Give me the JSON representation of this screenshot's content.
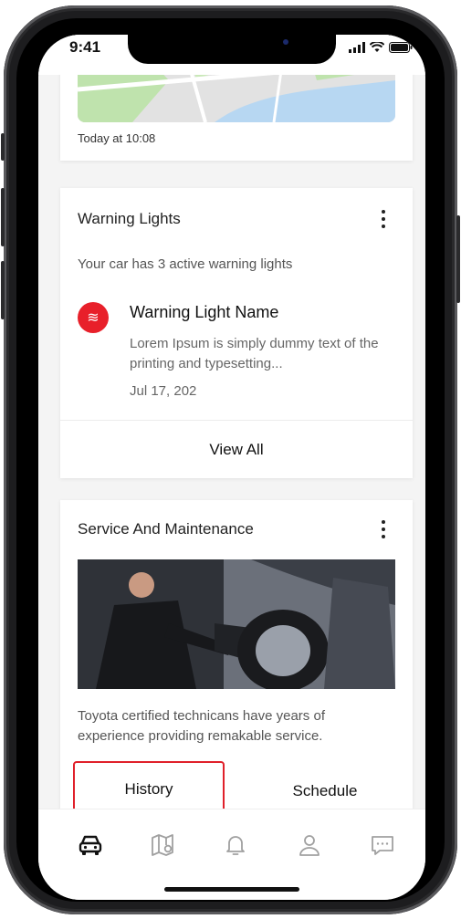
{
  "status_bar": {
    "time": "9:41"
  },
  "map_card": {
    "timestamp": "Today at 10:08"
  },
  "warning_card": {
    "title": "Warning Lights",
    "subtitle": "Your car has 3 active warning lights",
    "item": {
      "icon": "warning-light-icon",
      "name": "Warning Light Name",
      "description": "Lorem Ipsum is simply dummy text of the printing and typesetting...",
      "date": "Jul 17, 202"
    },
    "view_all_label": "View All"
  },
  "service_card": {
    "title": "Service And Maintenance",
    "description": "Toyota certified technicans have years of experience providing remakable service.",
    "tabs": [
      {
        "label": "History",
        "selected": true
      },
      {
        "label": "Schedule",
        "selected": false
      }
    ]
  },
  "bottom_nav": {
    "items": [
      {
        "icon": "car-icon",
        "active": true
      },
      {
        "icon": "map-icon",
        "active": false
      },
      {
        "icon": "bell-icon",
        "active": false
      },
      {
        "icon": "person-icon",
        "active": false
      },
      {
        "icon": "chat-icon",
        "active": false
      }
    ]
  },
  "colors": {
    "accent_red": "#e8202a",
    "highlight_border": "#e0202a"
  }
}
